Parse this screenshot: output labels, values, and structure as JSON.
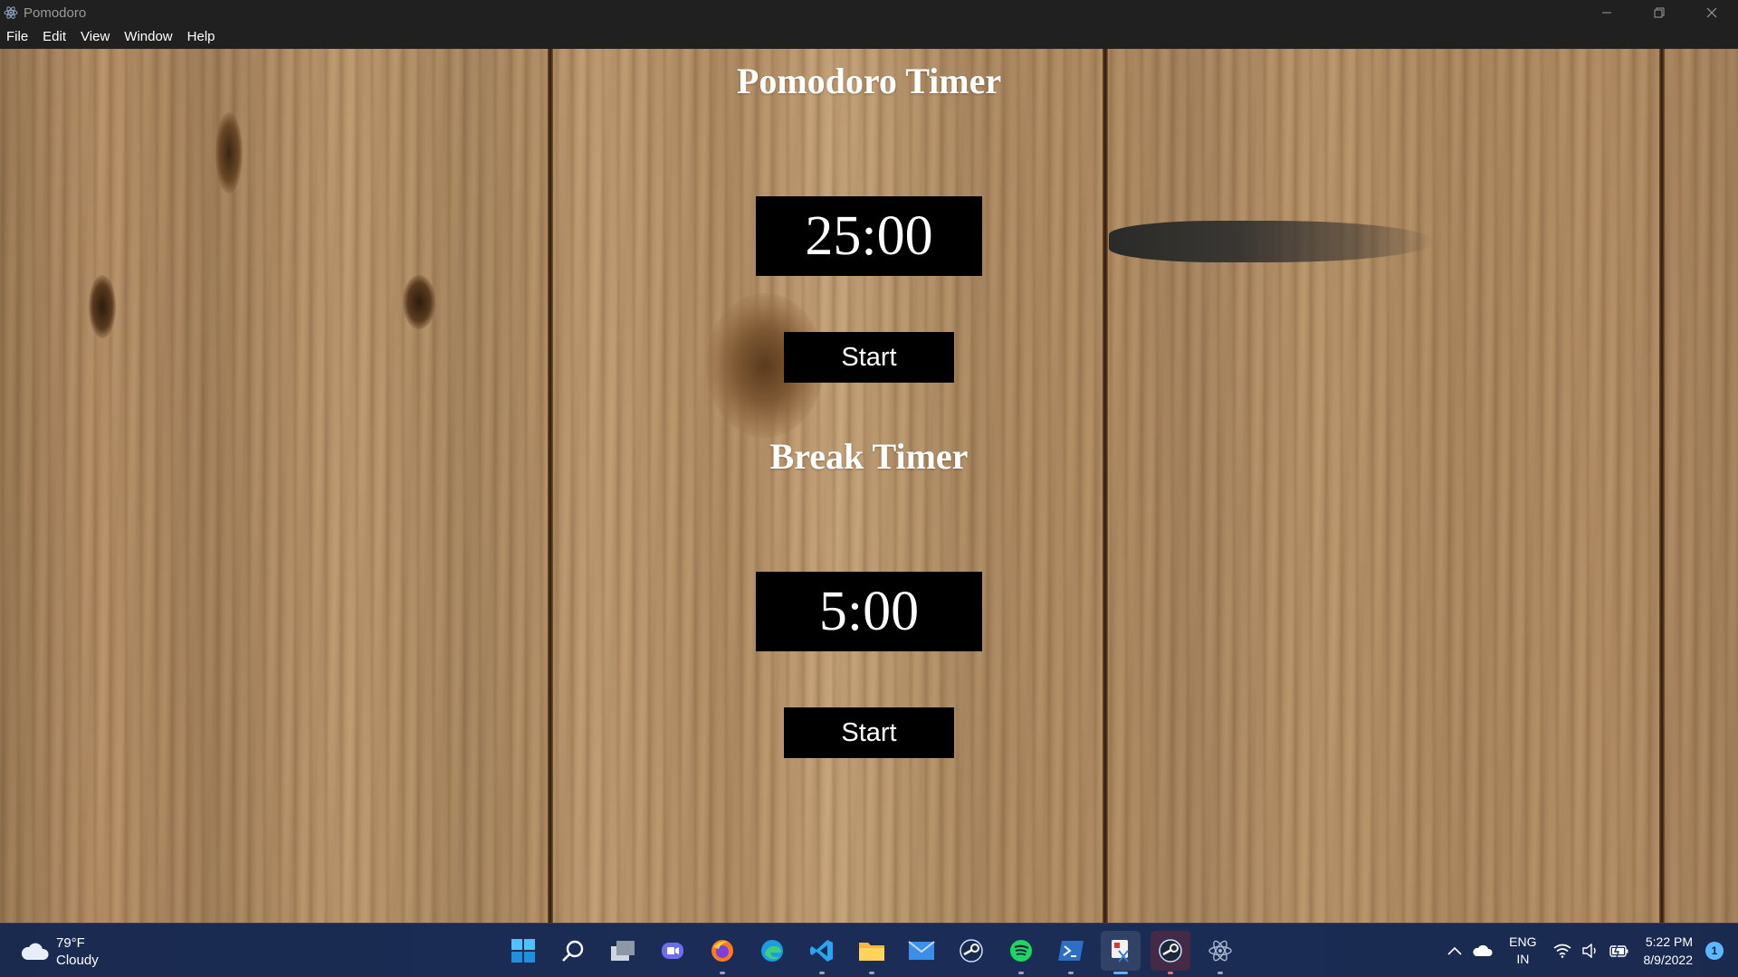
{
  "window": {
    "title": "Pomodoro",
    "controls": {
      "minimize": "minimize-icon",
      "restore": "restore-icon",
      "close": "close-icon"
    }
  },
  "menu": {
    "items": [
      {
        "label": "File"
      },
      {
        "label": "Edit"
      },
      {
        "label": "View"
      },
      {
        "label": "Window"
      },
      {
        "label": "Help"
      }
    ]
  },
  "pomodoro": {
    "heading": "Pomodoro Timer",
    "time": "25:00",
    "start_label": "Start"
  },
  "break": {
    "heading": "Break Timer",
    "time": "5:00",
    "start_label": "Start"
  },
  "taskbar": {
    "weather": {
      "temp": "79°F",
      "condition": "Cloudy",
      "icon": "cloud-icon"
    },
    "apps": [
      {
        "name": "start",
        "icon": "windows-start-icon"
      },
      {
        "name": "search",
        "icon": "search-icon"
      },
      {
        "name": "task-view",
        "icon": "task-view-icon"
      },
      {
        "name": "chat",
        "icon": "chat-icon"
      },
      {
        "name": "firefox",
        "icon": "firefox-icon"
      },
      {
        "name": "edge",
        "icon": "edge-icon"
      },
      {
        "name": "vscode",
        "icon": "vscode-icon"
      },
      {
        "name": "file-explorer",
        "icon": "folder-icon"
      },
      {
        "name": "mail",
        "icon": "mail-icon"
      },
      {
        "name": "steam",
        "icon": "steam-icon"
      },
      {
        "name": "spotify",
        "icon": "spotify-icon"
      },
      {
        "name": "powershell",
        "icon": "terminal-icon"
      },
      {
        "name": "snipping-tool",
        "icon": "snip-icon"
      },
      {
        "name": "steam-active",
        "icon": "steam-icon"
      },
      {
        "name": "electron",
        "icon": "electron-icon"
      }
    ],
    "tray": {
      "language_top": "ENG",
      "language_bottom": "IN",
      "time": "5:22 PM",
      "date": "8/9/2022",
      "notification_count": "1"
    }
  },
  "colors": {
    "titlebar_bg": "#202020",
    "timer_bg": "#000000",
    "heading_text": "#ffffff",
    "taskbar_bg": "#1b2d57",
    "accent": "#60b0ff"
  }
}
